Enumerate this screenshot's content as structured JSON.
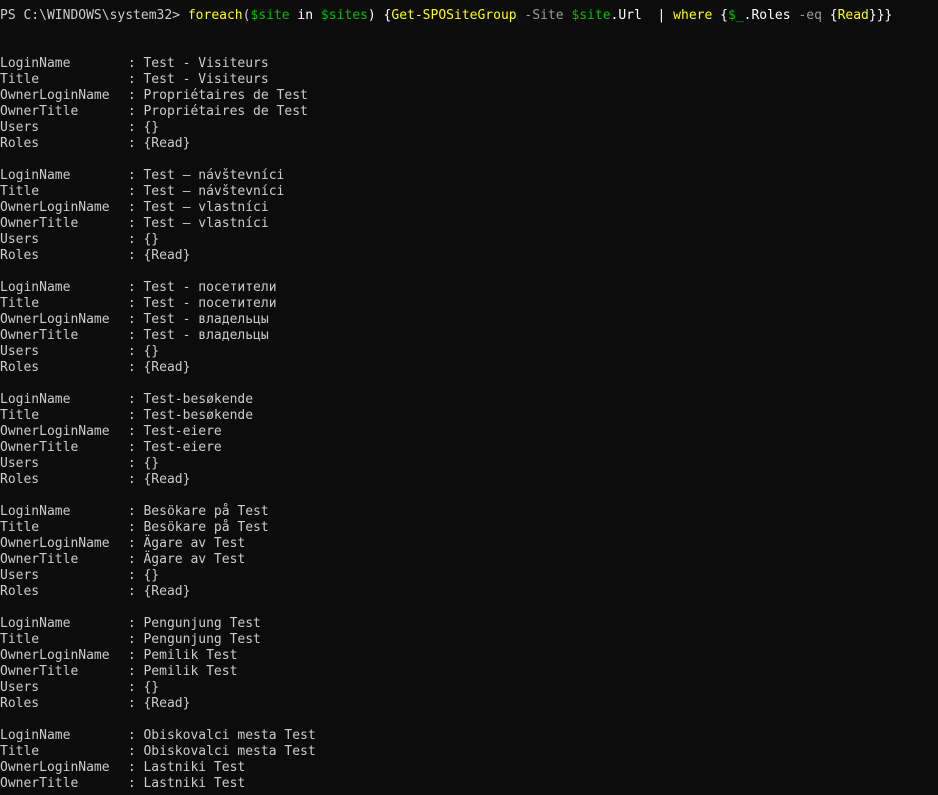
{
  "window": {
    "prompt": "PS C:\\WINDOWS\\system32> ",
    "command": {
      "foreach": "foreach",
      "paren_open": "(",
      "site_var": "$site",
      "in_kw": " in ",
      "sites_var": "$sites",
      "paren_close": ") {",
      "cmdlet": "Get-SPOSiteGroup",
      "param": " -Site ",
      "site_var2": "$site",
      "url_prop": ".Url",
      "pipe": "  | ",
      "where": "where",
      "brace_open": " {",
      "pipeline_var": "$_",
      "roles_prop": ".Roles",
      "eq_op": " -eq ",
      "brace_read": "{",
      "read": "Read",
      "brace_close": "}}}"
    }
  },
  "output": {
    "separator": " : ",
    "labels": {
      "login_name": "LoginName",
      "title": "Title",
      "owner_login_name": "OwnerLoginName",
      "owner_title": "OwnerTitle",
      "users": "Users",
      "roles": "Roles"
    },
    "groups": [
      {
        "login_name": "Test - Visiteurs",
        "title": "Test - Visiteurs",
        "owner_login_name": "Propriétaires de Test",
        "owner_title": "Propriétaires de Test",
        "users": "{}",
        "roles": "{Read}"
      },
      {
        "login_name": "Test – návštevníci",
        "title": "Test – návštevníci",
        "owner_login_name": "Test – vlastníci",
        "owner_title": "Test – vlastníci",
        "users": "{}",
        "roles": "{Read}"
      },
      {
        "login_name": "Test - посетители",
        "title": "Test - посетители",
        "owner_login_name": "Test - владельцы",
        "owner_title": "Test - владельцы",
        "users": "{}",
        "roles": "{Read}"
      },
      {
        "login_name": "Test-besøkende",
        "title": "Test-besøkende",
        "owner_login_name": "Test-eiere",
        "owner_title": "Test-eiere",
        "users": "{}",
        "roles": "{Read}"
      },
      {
        "login_name": "Besökare på Test",
        "title": "Besökare på Test",
        "owner_login_name": "Ägare av Test",
        "owner_title": "Ägare av Test",
        "users": "{}",
        "roles": "{Read}"
      },
      {
        "login_name": "Pengunjung Test",
        "title": "Pengunjung Test",
        "owner_login_name": "Pemilik Test",
        "owner_title": "Pemilik Test",
        "users": "{}",
        "roles": "{Read}"
      },
      {
        "login_name": "Obiskovalci mesta Test",
        "title": "Obiskovalci mesta Test",
        "owner_login_name": "Lastniki Test",
        "owner_title": "Lastniki Test"
      }
    ]
  }
}
